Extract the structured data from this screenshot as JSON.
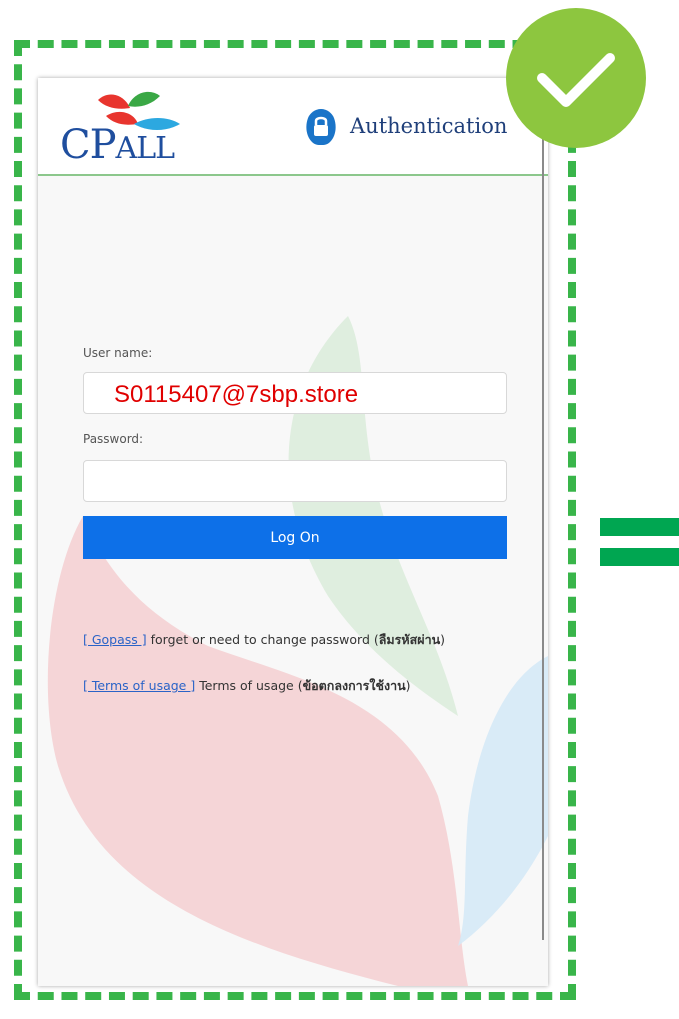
{
  "header": {
    "logo_text_big": "CP",
    "logo_text_small": "ALL",
    "auth_title": "Authentication"
  },
  "form": {
    "username_label": "User name:",
    "username_value": "S0115407@7sbp.store",
    "password_label": "Password:",
    "password_value": "",
    "logon_label": "Log On"
  },
  "links": [
    {
      "link_text": "[ Gopass ]",
      "desc": " forget or need to change password (",
      "thai": "ลืมรหัสผ่าน",
      "close": ")"
    },
    {
      "link_text": "[ Terms of usage ]",
      "desc": " Terms of usage (",
      "thai": "ข้อตกลงการใช้งาน",
      "close": ")"
    }
  ],
  "colors": {
    "frame": "#39b54a",
    "check_badge": "#8dc63f",
    "equals": "#00a651",
    "button": "#0d70e8",
    "username_text": "#e00000"
  },
  "icons": {
    "auth": "lock-shield-icon",
    "check": "checkmark-icon"
  }
}
